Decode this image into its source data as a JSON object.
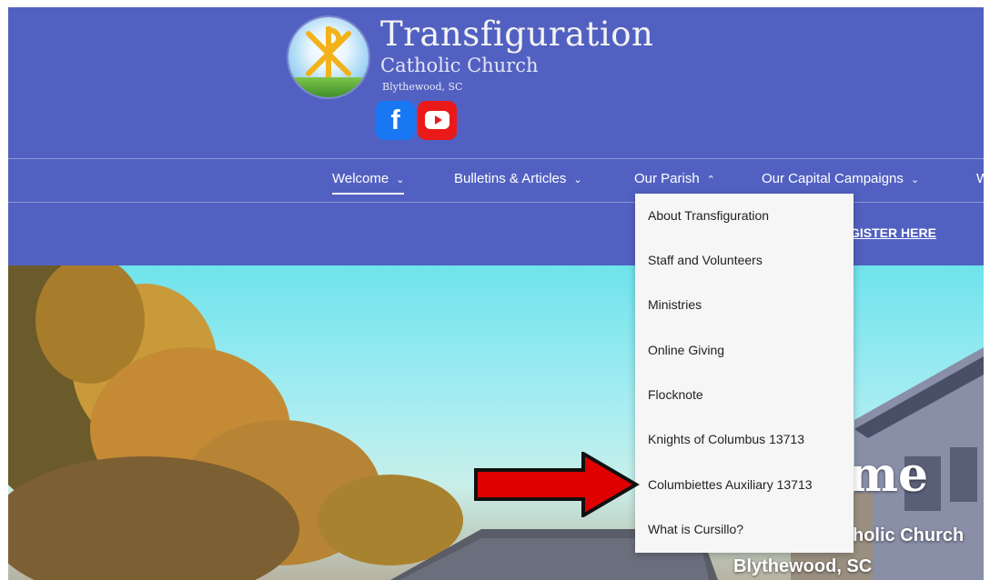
{
  "header": {
    "title": "Transfiguration",
    "subtitle": "Catholic Church",
    "location": "Blythewood, SC",
    "social": [
      {
        "icon": "facebook-icon",
        "glyph": "f",
        "color": "#1877f2"
      },
      {
        "icon": "youtube-icon",
        "color": "#ea1a1a"
      }
    ]
  },
  "nav": {
    "items": [
      {
        "label": "Welcome",
        "chevron": "⌄",
        "active": true
      },
      {
        "label": "Bulletins & Articles",
        "chevron": "⌄"
      },
      {
        "label": "Our Parish",
        "chevron": "⌃",
        "open": true
      },
      {
        "label": "Our Capital Campaigns",
        "chevron": "⌄"
      },
      {
        "label": "W"
      }
    ]
  },
  "banner": {
    "register_label": "GISTER HERE"
  },
  "dropdown": {
    "items": [
      "About Transfiguration",
      "Staff and Volunteers",
      "Ministries",
      "Online Giving",
      "Flocknote",
      "Knights of Columbus 13713",
      "Columbiettes Auxiliary 13713",
      "What is Cursillo?"
    ]
  },
  "hero": {
    "big_text": "me",
    "mid_text": "holic Church",
    "location": "Blythewood, SC"
  },
  "colors": {
    "header_bg": "#5261c1",
    "dropdown_bg": "#f6f6f6",
    "arrow": "#e00000"
  }
}
